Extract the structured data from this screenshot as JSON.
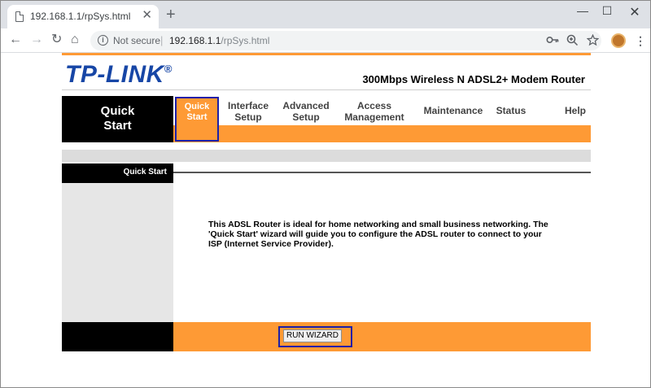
{
  "browser": {
    "tab_title": "192.168.1.1/rpSys.html",
    "tab_close": "✕",
    "new_tab": "+",
    "window_controls": {
      "minimize": "—",
      "maximize": "☐",
      "close": "✕"
    },
    "nav": {
      "back": "←",
      "forward": "→",
      "reload": "↻",
      "home": "⌂"
    },
    "security_label": "Not secure",
    "separator": "|",
    "url_host": "192.168.1.1",
    "url_path": "/rpSys.html",
    "icons": {
      "key": "key-icon",
      "zoom": "zoom-icon",
      "star": "star-icon",
      "menu": "menu-icon"
    }
  },
  "router": {
    "brand": "TP-LINK",
    "brand_mark": "®",
    "product_name": "300Mbps Wireless N ADSL2+ Modem Router",
    "nav_left_title_1": "Quick",
    "nav_left_title_2": "Start",
    "nav_items": [
      {
        "line1": "Quick",
        "line2": "Start"
      },
      {
        "line1": "Interface",
        "line2": "Setup"
      },
      {
        "line1": "Advanced",
        "line2": "Setup"
      },
      {
        "line1": "Access",
        "line2": "Management"
      },
      {
        "line1": "Maintenance",
        "line2": ""
      },
      {
        "line1": "Status",
        "line2": ""
      },
      {
        "line1": "Help",
        "line2": ""
      }
    ],
    "section_label": "Quick Start",
    "description": "This ADSL Router is ideal for home networking and small business networking. The 'Quick Start' wizard will guide you to configure the ADSL router to connect to your ISP (Internet Service Provider).",
    "wizard_button": "RUN WIZARD"
  },
  "colors": {
    "accent_orange": "#fe9a35",
    "brand_blue": "#1746a6",
    "highlight_frame": "#1d1fa8"
  }
}
